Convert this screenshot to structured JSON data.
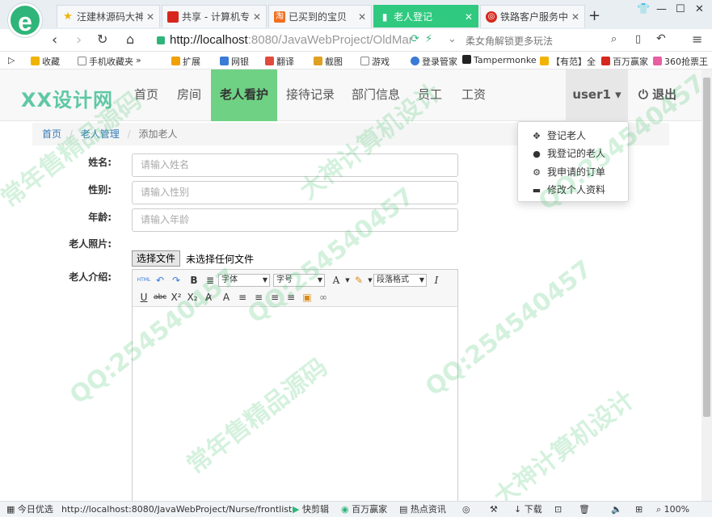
{
  "browser": {
    "logo_letter": "e",
    "tabs": [
      {
        "label": "汪建林源码大神",
        "icon": "star-icon",
        "color": "#f0b400"
      },
      {
        "label": "共享 - 计算机专",
        "icon": "red-square-icon",
        "color": "#d6281e"
      },
      {
        "label": "已买到的宝贝",
        "icon": "taobao-icon",
        "color": "#f26f21"
      },
      {
        "label": "老人登记",
        "icon": "page-icon",
        "color": "#ffffff",
        "active": true
      },
      {
        "label": "铁路客户服务中",
        "icon": "railway-icon",
        "color": "#d6281e"
      }
    ],
    "new_tab": "+",
    "url_host": "http://localhost",
    "url_rest": ":8080/JavaWebProject/OldMar",
    "search_hint": "柔女角解锁更多玩法"
  },
  "bookmarks": [
    {
      "label": "收藏",
      "color": "#f0b400"
    },
    {
      "label": "手机收藏夹",
      "color": "#888888"
    },
    {
      "label": "扩展",
      "color": "#f0a000"
    },
    {
      "label": "网银",
      "color": "#3a7bd5"
    },
    {
      "label": "翻译",
      "color": "#e04b3c"
    },
    {
      "label": "截图",
      "color": "#e0a020"
    },
    {
      "label": "游戏",
      "color": "#888888"
    },
    {
      "label": "登录管家",
      "color": "#3a7bd5"
    },
    {
      "label": "Tampermonke",
      "color": "#222222"
    },
    {
      "label": "【有范】全",
      "color": "#f0b400"
    },
    {
      "label": "百万赢家",
      "color": "#d6281e"
    },
    {
      "label": "360抢票王",
      "color": "#e95fa3"
    }
  ],
  "site": {
    "brand": "XX设计网",
    "nav": [
      "首页",
      "房间",
      "老人看护",
      "接待记录",
      "部门信息",
      "员工",
      "工资"
    ],
    "active_nav": "老人看护",
    "user": "user1 ▾",
    "logout": "退出"
  },
  "dropdown": [
    {
      "label": "登记老人",
      "icon": "move-icon",
      "glyph": "✥"
    },
    {
      "label": "我登记的老人",
      "icon": "user-icon",
      "glyph": "👤"
    },
    {
      "label": "我申请的订单",
      "icon": "cog-icon",
      "glyph": "⚙"
    },
    {
      "label": "修改个人资料",
      "icon": "credit-card-icon",
      "glyph": "▬"
    }
  ],
  "breadcrumb": [
    "首页",
    "老人管理",
    "添加老人"
  ],
  "form": {
    "name_label": "姓名:",
    "name_placeholder": "请输入姓名",
    "gender_label": "性别:",
    "gender_placeholder": "请输入性别",
    "age_label": "年龄:",
    "age_placeholder": "请输入年龄",
    "photo_label": "老人照片:",
    "file_button": "选择文件",
    "file_status": "未选择任何文件",
    "intro_label": "老人介绍:"
  },
  "editor": {
    "font_family": "字体",
    "font_size": "字号",
    "paragraph": "段落格式"
  },
  "statusbar": {
    "left": "今日优选",
    "url": "http://localhost:8080/JavaWebProject/Nurse/frontlist",
    "items": [
      "快剪辑",
      "百万赢家",
      "热点资讯"
    ],
    "download": "下载",
    "zoom": "100%"
  },
  "watermarks": [
    "常年售精品源码",
    "QQ:254540457",
    "大神计算机设计"
  ]
}
